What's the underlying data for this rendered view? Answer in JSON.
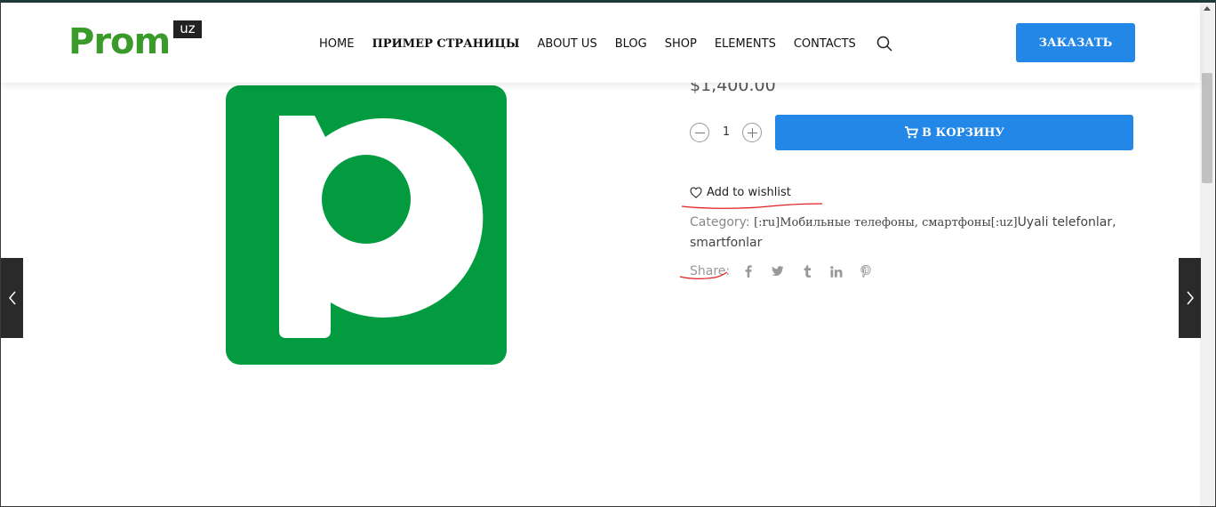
{
  "header": {
    "logo_text": "Prom",
    "logo_badge": "uz",
    "nav": [
      {
        "label": "HOME"
      },
      {
        "label": "ПРИМЕР СТРАНИЦЫ"
      },
      {
        "label": "ABOUT US"
      },
      {
        "label": "BLOG"
      },
      {
        "label": "SHOP"
      },
      {
        "label": "ELEMENTS"
      },
      {
        "label": "CONTACTS"
      }
    ],
    "search_icon": "search-icon",
    "order_button": "ЗАКАЗАТЬ"
  },
  "product": {
    "image_letter": "p",
    "image_color": "#039b3f",
    "price": "$1,400.00",
    "quantity": "1",
    "add_to_cart": "В КОРЗИНУ",
    "wishlist": "Add to wishlist",
    "category_label": "Category:",
    "category_value_serif": "[:ru]Мобильные телефоны, смартфоны[:uz]",
    "category_value_sans": "Uyali telefonlar, smartfonlar",
    "share_label": "Share:",
    "share_icons": [
      "facebook-icon",
      "twitter-icon",
      "tumblr-icon",
      "linkedin-icon",
      "pinterest-icon"
    ]
  },
  "colors": {
    "accent": "#2287e6",
    "brand_green": "#3a9b2a",
    "annotation_red": "#e02020"
  }
}
